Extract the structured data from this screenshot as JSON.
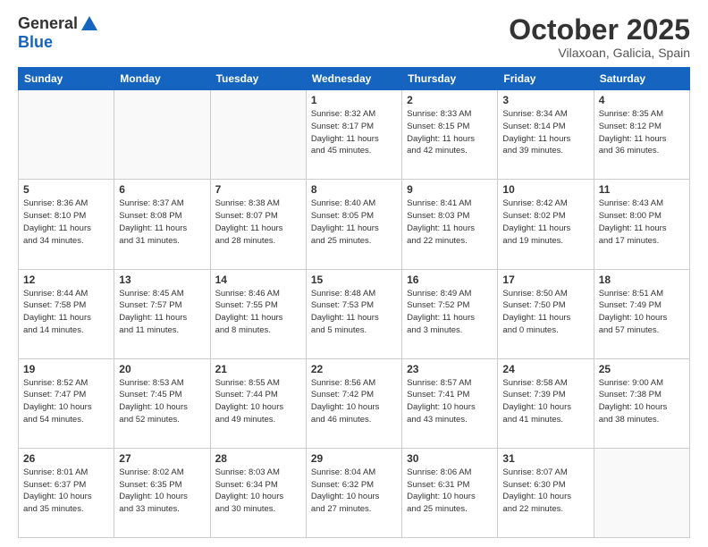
{
  "header": {
    "logo_line1": "General",
    "logo_line2": "Blue",
    "month_title": "October 2025",
    "location": "Vilaxoan, Galicia, Spain"
  },
  "weekdays": [
    "Sunday",
    "Monday",
    "Tuesday",
    "Wednesday",
    "Thursday",
    "Friday",
    "Saturday"
  ],
  "weeks": [
    [
      {
        "day": "",
        "info": ""
      },
      {
        "day": "",
        "info": ""
      },
      {
        "day": "",
        "info": ""
      },
      {
        "day": "1",
        "info": "Sunrise: 8:32 AM\nSunset: 8:17 PM\nDaylight: 11 hours\nand 45 minutes."
      },
      {
        "day": "2",
        "info": "Sunrise: 8:33 AM\nSunset: 8:15 PM\nDaylight: 11 hours\nand 42 minutes."
      },
      {
        "day": "3",
        "info": "Sunrise: 8:34 AM\nSunset: 8:14 PM\nDaylight: 11 hours\nand 39 minutes."
      },
      {
        "day": "4",
        "info": "Sunrise: 8:35 AM\nSunset: 8:12 PM\nDaylight: 11 hours\nand 36 minutes."
      }
    ],
    [
      {
        "day": "5",
        "info": "Sunrise: 8:36 AM\nSunset: 8:10 PM\nDaylight: 11 hours\nand 34 minutes."
      },
      {
        "day": "6",
        "info": "Sunrise: 8:37 AM\nSunset: 8:08 PM\nDaylight: 11 hours\nand 31 minutes."
      },
      {
        "day": "7",
        "info": "Sunrise: 8:38 AM\nSunset: 8:07 PM\nDaylight: 11 hours\nand 28 minutes."
      },
      {
        "day": "8",
        "info": "Sunrise: 8:40 AM\nSunset: 8:05 PM\nDaylight: 11 hours\nand 25 minutes."
      },
      {
        "day": "9",
        "info": "Sunrise: 8:41 AM\nSunset: 8:03 PM\nDaylight: 11 hours\nand 22 minutes."
      },
      {
        "day": "10",
        "info": "Sunrise: 8:42 AM\nSunset: 8:02 PM\nDaylight: 11 hours\nand 19 minutes."
      },
      {
        "day": "11",
        "info": "Sunrise: 8:43 AM\nSunset: 8:00 PM\nDaylight: 11 hours\nand 17 minutes."
      }
    ],
    [
      {
        "day": "12",
        "info": "Sunrise: 8:44 AM\nSunset: 7:58 PM\nDaylight: 11 hours\nand 14 minutes."
      },
      {
        "day": "13",
        "info": "Sunrise: 8:45 AM\nSunset: 7:57 PM\nDaylight: 11 hours\nand 11 minutes."
      },
      {
        "day": "14",
        "info": "Sunrise: 8:46 AM\nSunset: 7:55 PM\nDaylight: 11 hours\nand 8 minutes."
      },
      {
        "day": "15",
        "info": "Sunrise: 8:48 AM\nSunset: 7:53 PM\nDaylight: 11 hours\nand 5 minutes."
      },
      {
        "day": "16",
        "info": "Sunrise: 8:49 AM\nSunset: 7:52 PM\nDaylight: 11 hours\nand 3 minutes."
      },
      {
        "day": "17",
        "info": "Sunrise: 8:50 AM\nSunset: 7:50 PM\nDaylight: 11 hours\nand 0 minutes."
      },
      {
        "day": "18",
        "info": "Sunrise: 8:51 AM\nSunset: 7:49 PM\nDaylight: 10 hours\nand 57 minutes."
      }
    ],
    [
      {
        "day": "19",
        "info": "Sunrise: 8:52 AM\nSunset: 7:47 PM\nDaylight: 10 hours\nand 54 minutes."
      },
      {
        "day": "20",
        "info": "Sunrise: 8:53 AM\nSunset: 7:45 PM\nDaylight: 10 hours\nand 52 minutes."
      },
      {
        "day": "21",
        "info": "Sunrise: 8:55 AM\nSunset: 7:44 PM\nDaylight: 10 hours\nand 49 minutes."
      },
      {
        "day": "22",
        "info": "Sunrise: 8:56 AM\nSunset: 7:42 PM\nDaylight: 10 hours\nand 46 minutes."
      },
      {
        "day": "23",
        "info": "Sunrise: 8:57 AM\nSunset: 7:41 PM\nDaylight: 10 hours\nand 43 minutes."
      },
      {
        "day": "24",
        "info": "Sunrise: 8:58 AM\nSunset: 7:39 PM\nDaylight: 10 hours\nand 41 minutes."
      },
      {
        "day": "25",
        "info": "Sunrise: 9:00 AM\nSunset: 7:38 PM\nDaylight: 10 hours\nand 38 minutes."
      }
    ],
    [
      {
        "day": "26",
        "info": "Sunrise: 8:01 AM\nSunset: 6:37 PM\nDaylight: 10 hours\nand 35 minutes."
      },
      {
        "day": "27",
        "info": "Sunrise: 8:02 AM\nSunset: 6:35 PM\nDaylight: 10 hours\nand 33 minutes."
      },
      {
        "day": "28",
        "info": "Sunrise: 8:03 AM\nSunset: 6:34 PM\nDaylight: 10 hours\nand 30 minutes."
      },
      {
        "day": "29",
        "info": "Sunrise: 8:04 AM\nSunset: 6:32 PM\nDaylight: 10 hours\nand 27 minutes."
      },
      {
        "day": "30",
        "info": "Sunrise: 8:06 AM\nSunset: 6:31 PM\nDaylight: 10 hours\nand 25 minutes."
      },
      {
        "day": "31",
        "info": "Sunrise: 8:07 AM\nSunset: 6:30 PM\nDaylight: 10 hours\nand 22 minutes."
      },
      {
        "day": "",
        "info": ""
      }
    ]
  ]
}
